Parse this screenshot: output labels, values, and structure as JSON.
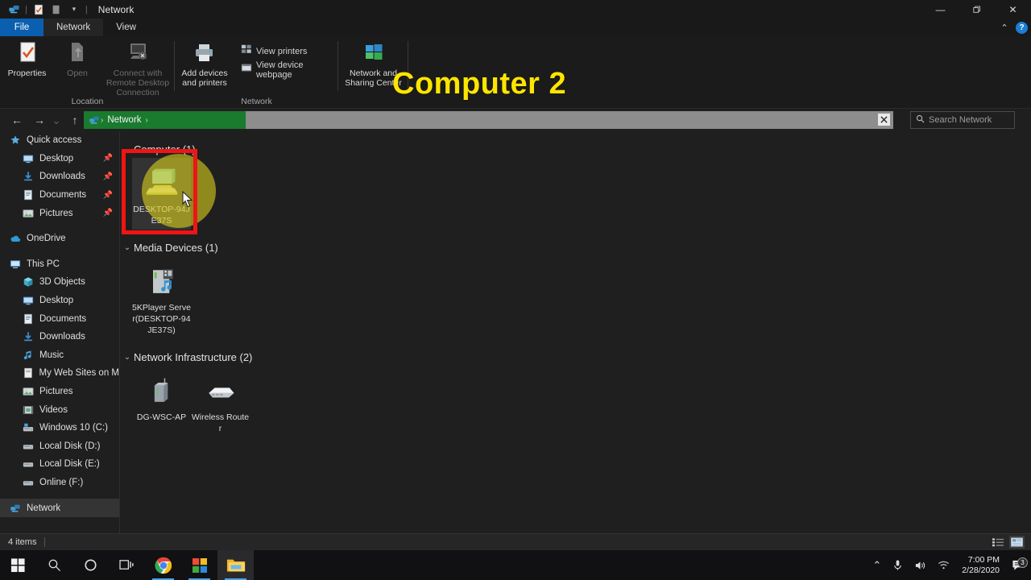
{
  "window": {
    "title": "Network",
    "quick_access_icons": [
      "network-icon",
      "properties-icon",
      "folder-icon",
      "dropdown-icon"
    ],
    "controls": {
      "minimize": "—",
      "maximize": "❐",
      "close": "✕"
    }
  },
  "tabs": [
    {
      "label": "File",
      "kind": "file"
    },
    {
      "label": "Network",
      "kind": "active"
    },
    {
      "label": "View",
      "kind": "normal"
    }
  ],
  "ribbon": {
    "collapse_label": "⌃",
    "help_label": "?",
    "groups": [
      {
        "name": "Location",
        "label": "Location",
        "buttons": [
          {
            "label": "Properties",
            "icon": "properties-icon",
            "enabled": true
          },
          {
            "label": "Open",
            "icon": "open-icon",
            "enabled": false
          },
          {
            "label": "Connect with Remote Desktop Connection",
            "icon": "remote-desktop-icon",
            "enabled": false
          }
        ]
      },
      {
        "name": "Network",
        "label": "Network",
        "buttons": [
          {
            "label": "Add devices and printers",
            "icon": "printer-icon",
            "enabled": true
          }
        ],
        "small_buttons": [
          {
            "label": "View printers",
            "icon": "view-printers-icon"
          },
          {
            "label": "View device webpage",
            "icon": "view-webpage-icon"
          }
        ]
      },
      {
        "name": "NetworkSharing",
        "label": "",
        "buttons": [
          {
            "label": "Network and Sharing Center",
            "icon": "network-sharing-icon",
            "enabled": true
          }
        ]
      }
    ]
  },
  "addressbar": {
    "back": "←",
    "forward": "→",
    "recent": "⌄",
    "up": "↑",
    "crumb_icon": "network-icon",
    "crumb_text": "Network",
    "crumb_sep": "›",
    "clear_label": "✕",
    "search_icon": "search-icon",
    "search_placeholder": "Search Network",
    "search_value": ""
  },
  "sidebar": {
    "items": [
      {
        "label": "Quick access",
        "icon": "star-icon",
        "indent": 0,
        "pinned": false,
        "selected": false
      },
      {
        "label": "Desktop",
        "icon": "desktop-icon",
        "indent": 1,
        "pinned": true,
        "selected": false
      },
      {
        "label": "Downloads",
        "icon": "download-icon",
        "indent": 1,
        "pinned": true,
        "selected": false
      },
      {
        "label": "Documents",
        "icon": "documents-icon",
        "indent": 1,
        "pinned": true,
        "selected": false
      },
      {
        "label": "Pictures",
        "icon": "pictures-icon",
        "indent": 1,
        "pinned": true,
        "selected": false
      },
      {
        "label": "OneDrive",
        "icon": "onedrive-icon",
        "indent": 0,
        "pinned": false,
        "selected": false,
        "gap_before": true
      },
      {
        "label": "This PC",
        "icon": "thispc-icon",
        "indent": 0,
        "pinned": false,
        "selected": false,
        "gap_before": true
      },
      {
        "label": "3D Objects",
        "icon": "3dobjects-icon",
        "indent": 1,
        "pinned": false,
        "selected": false
      },
      {
        "label": "Desktop",
        "icon": "desktop-icon",
        "indent": 1,
        "pinned": false,
        "selected": false
      },
      {
        "label": "Documents",
        "icon": "documents-icon",
        "indent": 1,
        "pinned": false,
        "selected": false
      },
      {
        "label": "Downloads",
        "icon": "download-icon",
        "indent": 1,
        "pinned": false,
        "selected": false
      },
      {
        "label": "Music",
        "icon": "music-icon",
        "indent": 1,
        "pinned": false,
        "selected": false
      },
      {
        "label": "My Web Sites on M",
        "icon": "website-icon",
        "indent": 1,
        "pinned": false,
        "selected": false
      },
      {
        "label": "Pictures",
        "icon": "pictures-icon",
        "indent": 1,
        "pinned": false,
        "selected": false
      },
      {
        "label": "Videos",
        "icon": "videos-icon",
        "indent": 1,
        "pinned": false,
        "selected": false
      },
      {
        "label": "Windows 10 (C:)",
        "icon": "windows-drive-icon",
        "indent": 1,
        "pinned": false,
        "selected": false
      },
      {
        "label": "Local Disk (D:)",
        "icon": "drive-icon",
        "indent": 1,
        "pinned": false,
        "selected": false
      },
      {
        "label": "Local Disk (E:)",
        "icon": "drive-icon",
        "indent": 1,
        "pinned": false,
        "selected": false
      },
      {
        "label": "Online (F:)",
        "icon": "drive-icon",
        "indent": 1,
        "pinned": false,
        "selected": false
      },
      {
        "label": "Network",
        "icon": "network-icon",
        "indent": 0,
        "pinned": false,
        "selected": true,
        "gap_before": true
      }
    ]
  },
  "content": {
    "groups": [
      {
        "title": "Computer (1)",
        "chevron": "⌄",
        "items": [
          {
            "label": "DESKTOP-94JE37S",
            "icon": "computer-icon",
            "selected": true
          }
        ]
      },
      {
        "title": "Media Devices (1)",
        "chevron": "⌄",
        "items": [
          {
            "label": "5KPlayer Server(DESKTOP-94JE37S)",
            "icon": "media-device-icon",
            "selected": false
          }
        ]
      },
      {
        "title": "Network Infrastructure (2)",
        "chevron": "⌄",
        "items": [
          {
            "label": "DG-WSC-AP",
            "icon": "access-point-icon",
            "selected": false
          },
          {
            "label": "Wireless Router",
            "icon": "router-icon",
            "selected": false
          }
        ]
      }
    ]
  },
  "statusbar": {
    "item_count": "4 items",
    "secondary": "",
    "view_details_icon": "details-view-icon",
    "view_tiles_icon": "tiles-view-icon"
  },
  "taskbar": {
    "left_items": [
      {
        "name": "start-button",
        "icon": "windows-logo-icon",
        "active": false,
        "running": false
      },
      {
        "name": "search-button",
        "icon": "search-icon",
        "active": false,
        "running": false
      },
      {
        "name": "cortana-button",
        "icon": "cortana-circle-icon",
        "active": false,
        "running": false
      },
      {
        "name": "task-view-button",
        "icon": "task-view-icon",
        "active": false,
        "running": false
      },
      {
        "name": "chrome-button",
        "icon": "chrome-icon",
        "active": false,
        "running": true
      },
      {
        "name": "microsoft-store-button",
        "icon": "store-icon",
        "active": false,
        "running": true
      },
      {
        "name": "file-explorer-button",
        "icon": "folder-icon",
        "active": true,
        "running": true
      }
    ],
    "tray": {
      "overflow": "⌃",
      "microphone_icon": "microphone-icon",
      "volume_icon": "volume-icon",
      "wifi_icon": "wifi-icon",
      "time": "7:00 PM",
      "date": "2/28/2020",
      "action_center_icon": "action-center-icon",
      "notification_count": "3"
    }
  },
  "overlay": {
    "annotation_text": "Computer 2",
    "annotation_color": "#FFE500",
    "highlight_box_color": "#F01414",
    "click_indicator_color": "rgba(214,203,30,0.62)"
  }
}
